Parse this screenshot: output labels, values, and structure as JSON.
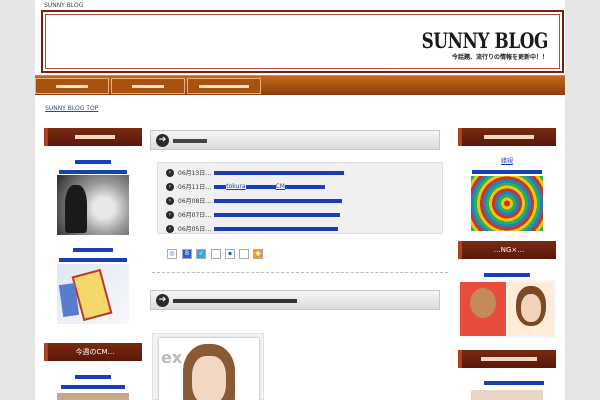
{
  "header": {
    "tagline": "SUNNY BLOG",
    "logo_title": "SUNNY BLOG",
    "logo_subtitle": "今話題、流行りの情報を更新中！！"
  },
  "breadcrumb": "SUNNY BLOG TOP",
  "left_sidebar": {
    "section2_title": "今週のCM…",
    "link_partial": "…"
  },
  "right_sidebar": {
    "item1_title": "錯視",
    "section2_title": "…NG×…",
    "link_partial": "…"
  },
  "news_list": {
    "dates": [
      "06月13日…",
      "06月11日…",
      "06月08日…",
      "06月07日…",
      "06月05日…"
    ],
    "row2_fragment": "tokura",
    "row2_fragment2": "CM"
  },
  "colors": {
    "nav_top": "#c2691c",
    "nav_bottom": "#8c3e0a",
    "sidebar_header": "#6a200d",
    "link": "#1a3fb3"
  },
  "icons": [
    "arrow-right-icon",
    "share-icon"
  ]
}
